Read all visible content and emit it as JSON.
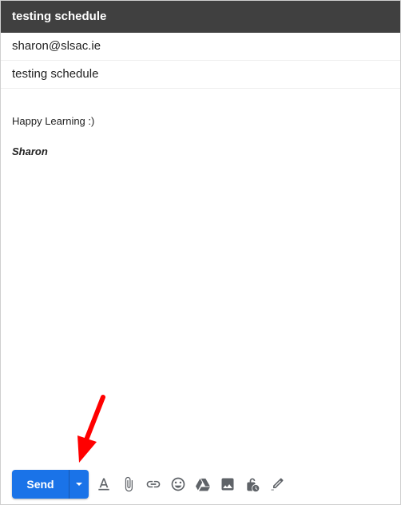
{
  "header": {
    "title": "testing schedule"
  },
  "compose": {
    "recipient": "sharon@slsac.ie",
    "subject": "testing schedule",
    "body": "Happy Learning :)",
    "signature": "Sharon"
  },
  "toolbar": {
    "send_label": "Send",
    "icons": [
      "formatting-options-icon",
      "attach-file-icon",
      "insert-link-icon",
      "insert-emoji-icon",
      "google-drive-icon",
      "insert-photo-icon",
      "confidential-mode-icon",
      "signature-icon"
    ]
  },
  "annotation": {
    "arrow_color": "#ff0000"
  },
  "colors": {
    "header_bg": "#404040",
    "send_button": "#1a73e8"
  }
}
